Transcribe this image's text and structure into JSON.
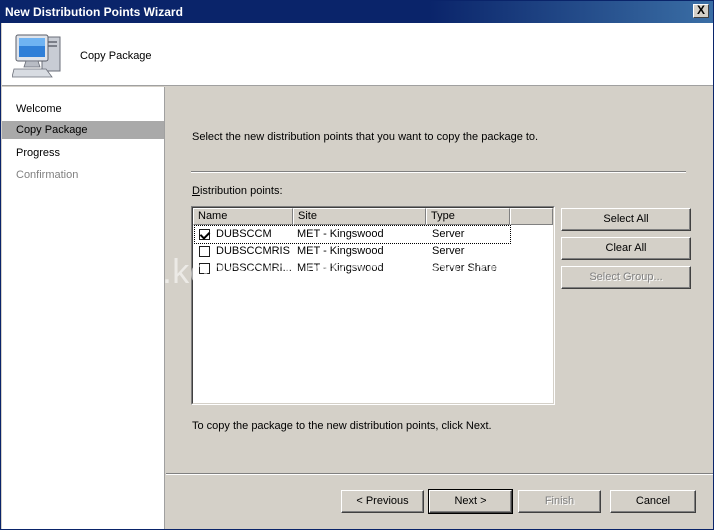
{
  "window": {
    "title": "New Distribution Points Wizard",
    "close_label": "X"
  },
  "header": {
    "title": "Copy Package",
    "icon": "computer-monitor-icon"
  },
  "sidebar": {
    "steps": [
      {
        "label": "Welcome",
        "state": "normal"
      },
      {
        "label": "Copy Package",
        "state": "active"
      },
      {
        "label": "Progress",
        "state": "normal"
      },
      {
        "label": "Confirmation",
        "state": "disabled"
      }
    ]
  },
  "main": {
    "instruction": "Select the new distribution points that you want to copy the package to.",
    "list_label_prefix": "D",
    "list_label_rest": "istribution points:",
    "columns": [
      "Name",
      "Site",
      "Type"
    ],
    "rows": [
      {
        "checked": true,
        "name": "DUBSCCM",
        "site": "MET - Kingswood",
        "type": "Server"
      },
      {
        "checked": false,
        "name": "DUBSCCMRIS",
        "site": "MET - Kingswood",
        "type": "Server"
      },
      {
        "checked": false,
        "name": "DUBSCCMRI...",
        "site": "MET - Kingswood",
        "type": "Server Share"
      }
    ],
    "footer_text": "To copy the package to the new distribution points, click Next."
  },
  "side_buttons": {
    "select_all": "Select All",
    "clear_all": "Clear All",
    "select_group": "Select Group..."
  },
  "nav_buttons": {
    "previous": "< Previous",
    "next": "Next >",
    "finish": "Finish",
    "cancel": "Cancel"
  },
  "watermark": "www.kozeniauskas.com/itblog"
}
